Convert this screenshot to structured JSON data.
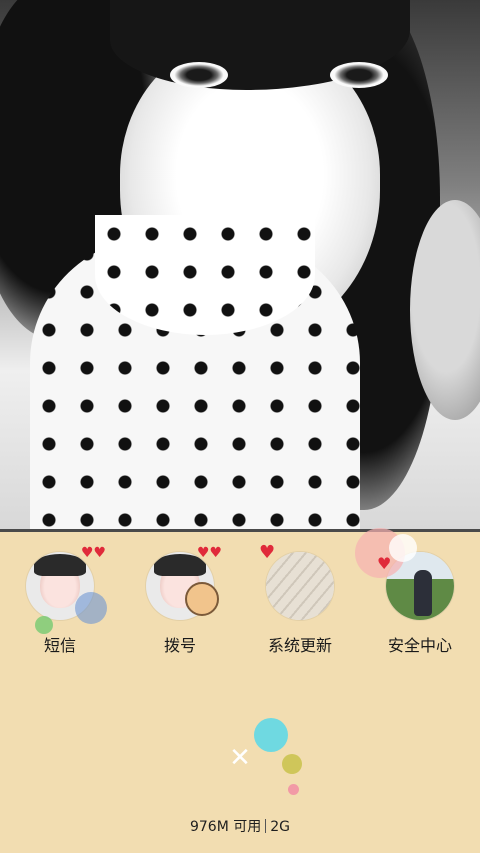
{
  "apps": [
    {
      "label": "短信",
      "icon": "avatar-girl-icon"
    },
    {
      "label": "拨号",
      "icon": "avatar-girl-cartoon-icon"
    },
    {
      "label": "系统更新",
      "icon": "sketch-drawing-icon"
    },
    {
      "label": "安全中心",
      "icon": "outdoor-photo-icon"
    }
  ],
  "status": {
    "memory_value": "976M 可用",
    "network": "2G"
  },
  "decor": {
    "close_symbol": "✕",
    "background_color": "#f2ddb1"
  }
}
